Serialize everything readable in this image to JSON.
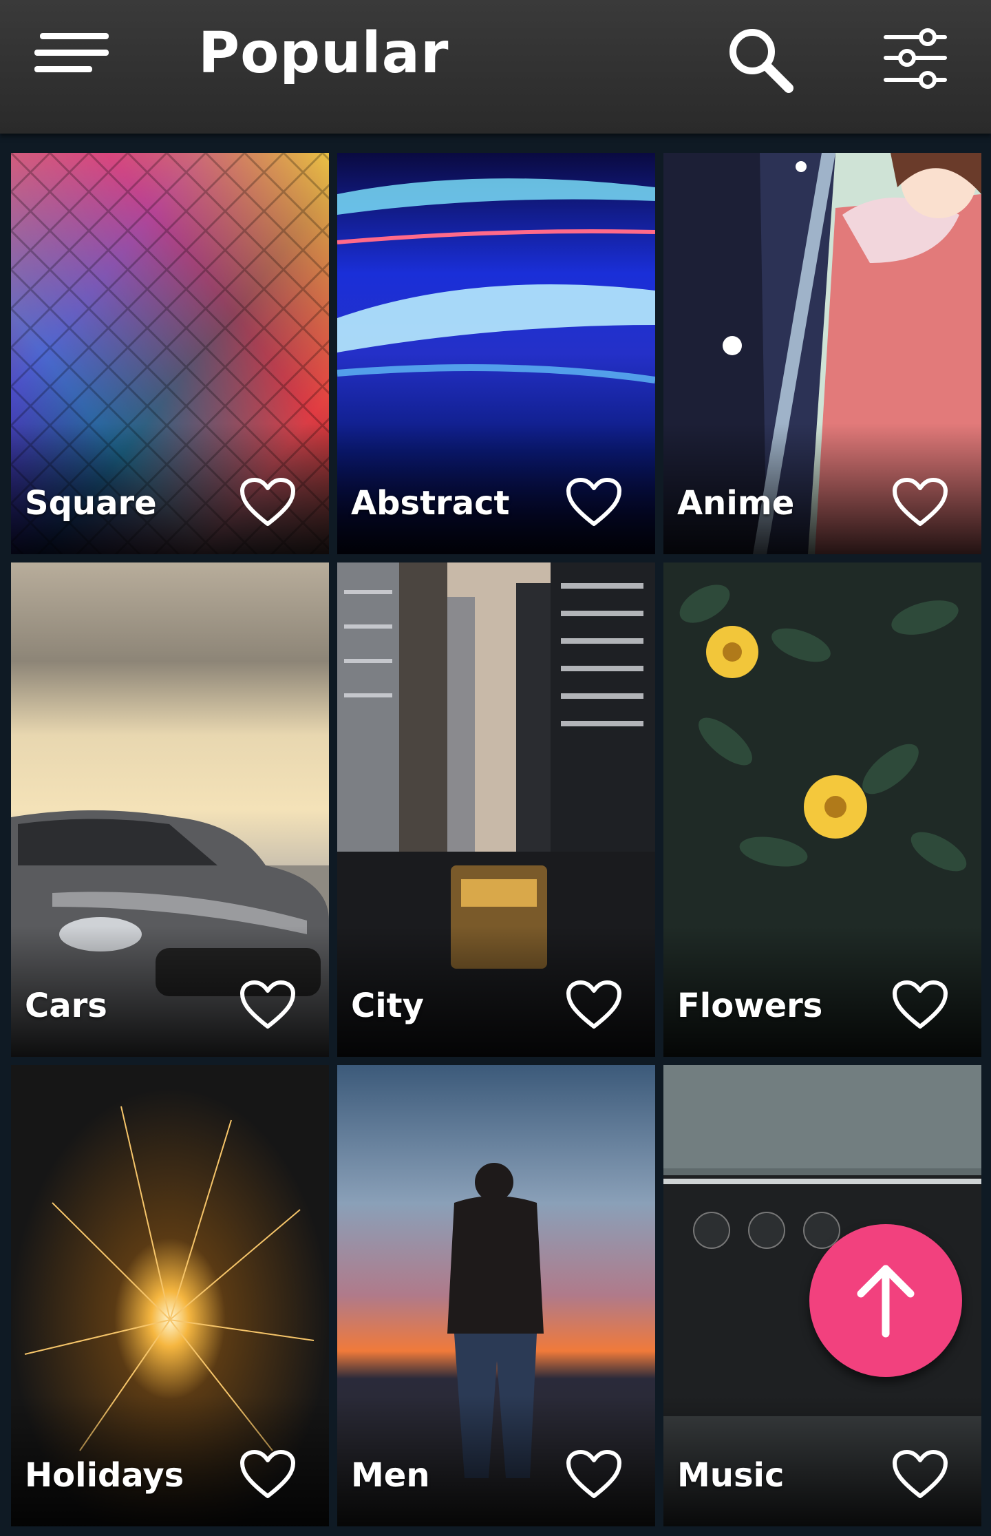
{
  "header": {
    "title": "Popular",
    "menu_icon": "hamburger-menu-icon",
    "search_icon": "search-icon",
    "filter_icon": "sliders-filter-icon"
  },
  "categories": [
    {
      "label": "Square",
      "favorite": false
    },
    {
      "label": "Abstract",
      "favorite": false
    },
    {
      "label": "Anime",
      "favorite": false
    },
    {
      "label": "Cars",
      "favorite": false
    },
    {
      "label": "City",
      "favorite": false
    },
    {
      "label": "Flowers",
      "favorite": false
    },
    {
      "label": "Holidays",
      "favorite": false
    },
    {
      "label": "Men",
      "favorite": false
    },
    {
      "label": "Music",
      "favorite": false
    }
  ],
  "fab": {
    "icon": "arrow-up-icon",
    "color": "#f2417e"
  },
  "colors": {
    "appbar": "#333333",
    "background": "#0f1a24",
    "accent": "#f2417e"
  }
}
